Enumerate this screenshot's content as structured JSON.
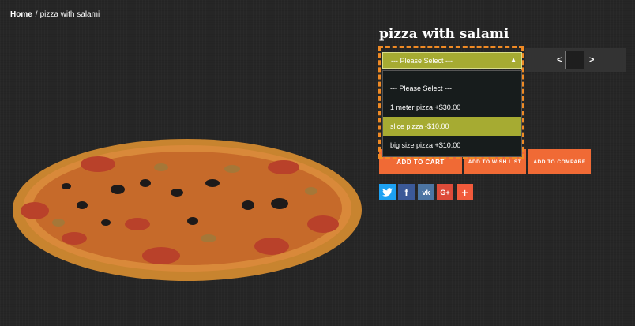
{
  "breadcrumb": {
    "home": "Home",
    "separator": "/",
    "current": "pizza with salami"
  },
  "product": {
    "title": "pizza with salami",
    "image_alt": "pizza with salami"
  },
  "options": {
    "selected_label": "--- Please Select ---",
    "items": [
      {
        "label": "--- Please Select ---"
      },
      {
        "label": "1 meter pizza +$30.00"
      },
      {
        "label": "slice pizza -$10.00",
        "highlighted": true
      },
      {
        "label": "big size pizza +$10.00"
      }
    ]
  },
  "quantity": {
    "prev": "<",
    "next": ">",
    "value": ""
  },
  "buttons": {
    "cart": "ADD TO CART",
    "wishlist": "ADD TO WISH LIST",
    "compare": "ADD TO COMPARE"
  },
  "share": {
    "twitter": "twitter-icon",
    "facebook": "f",
    "vk": "vk",
    "gplus": "G+",
    "more": "+"
  },
  "colors": {
    "accent": "#f06a35",
    "option_highlight": "#a6ab32",
    "dashed_outline": "#f08a24"
  }
}
